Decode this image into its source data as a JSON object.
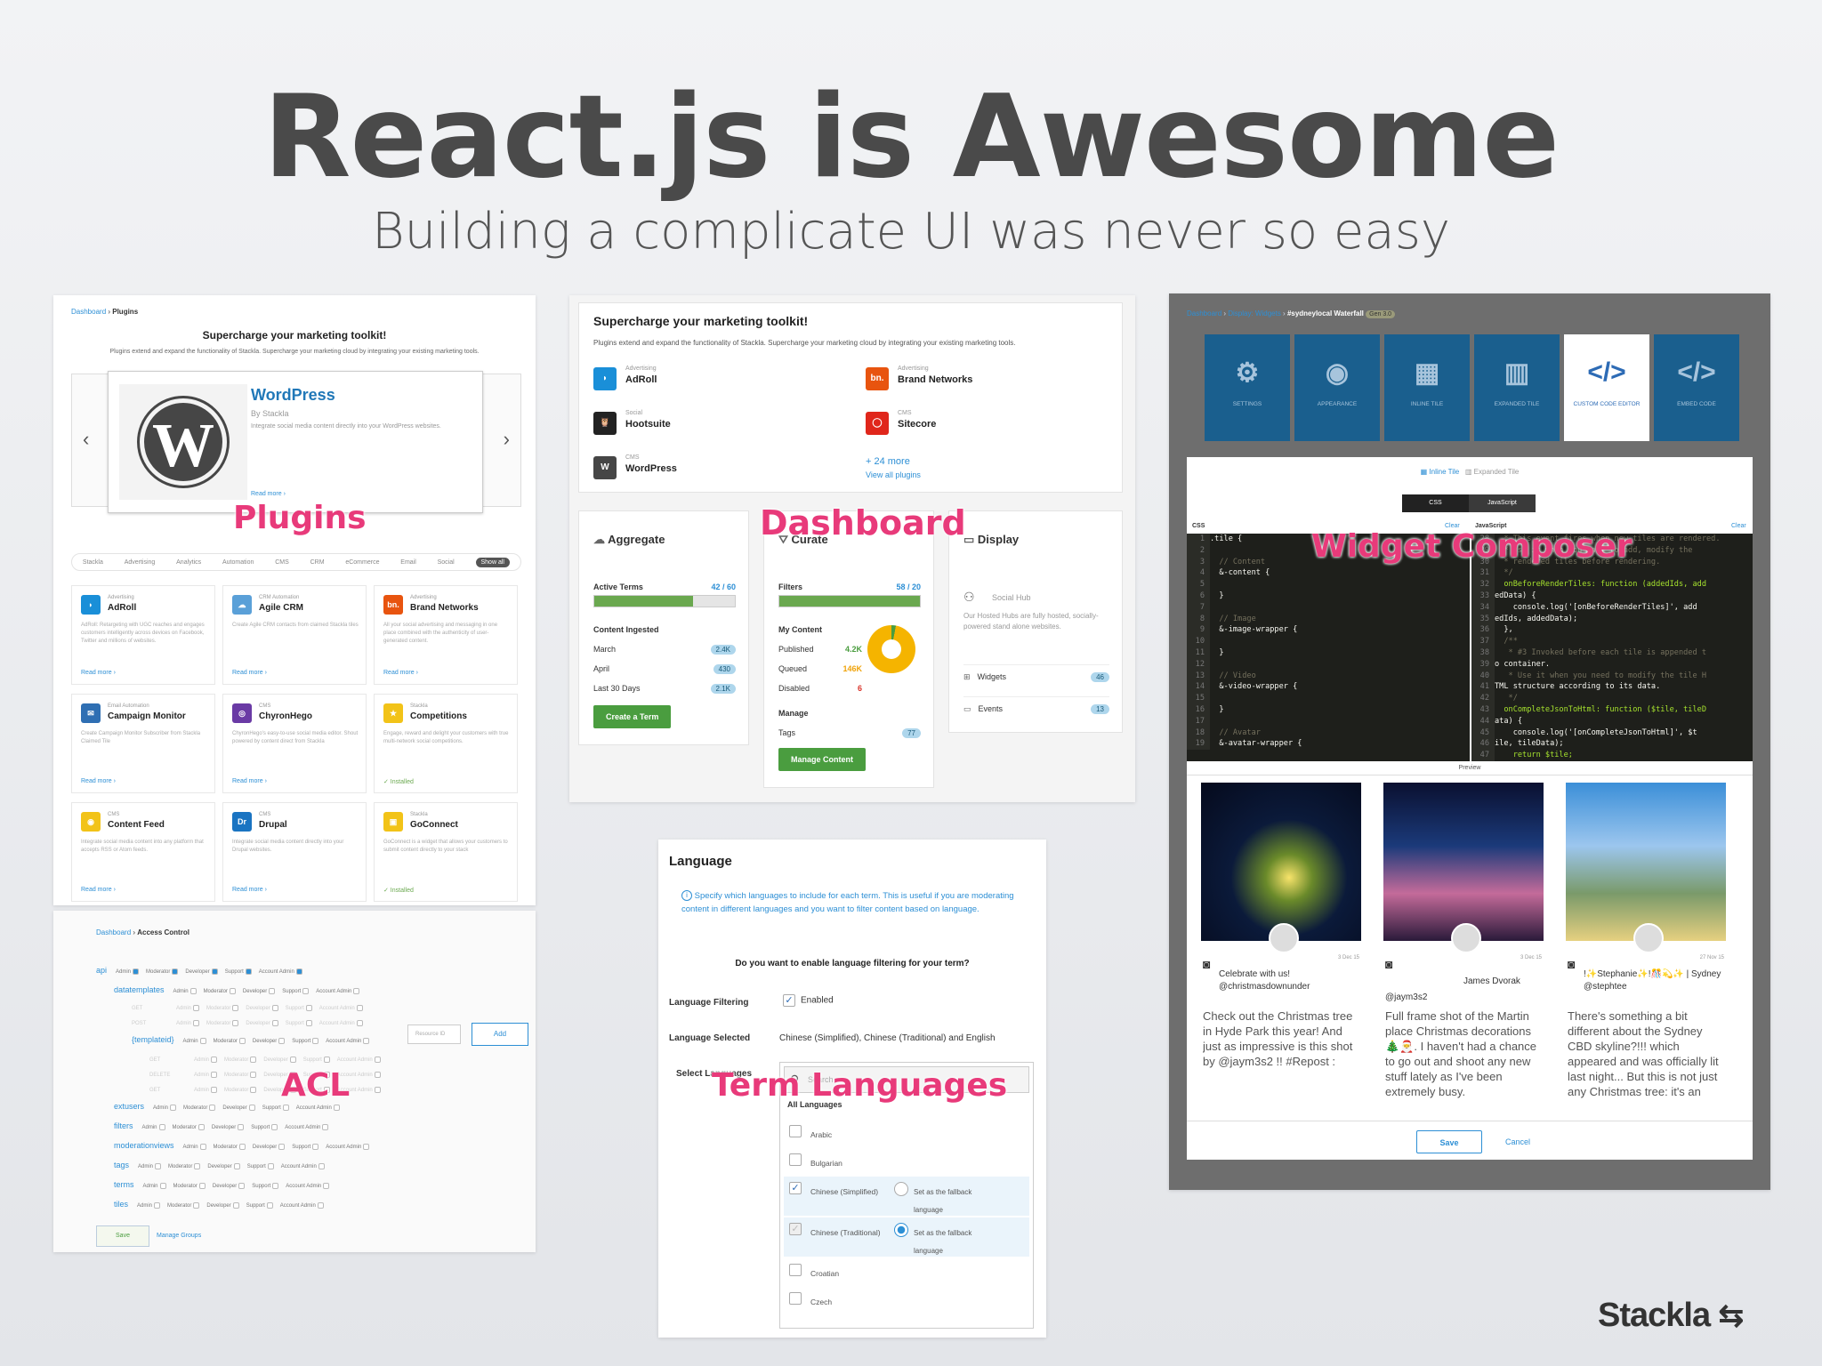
{
  "slide": {
    "title": "React.js is Awesome",
    "subtitle": "Building a complicate UI was never so easy",
    "brand": "Stackla"
  },
  "labels": {
    "plugins": "Plugins",
    "dashboard": "Dashboard",
    "widget": "Widget Composer",
    "acl": "ACL",
    "term_languages": "Term Languages"
  },
  "plugins": {
    "crumb_root": "Dashboard",
    "crumb_current": "Plugins",
    "heading": "Supercharge your marketing toolkit!",
    "desc": "Plugins extend and expand the functionality of Stackla. Supercharge your marketing cloud by integrating your existing marketing tools.",
    "featured": {
      "name": "WordPress",
      "by": "By Stackla",
      "desc": "Integrate social media content directly into your WordPress websites.",
      "read_more": "Read more ›"
    },
    "tabs": [
      "Stackla",
      "Advertising",
      "Analytics",
      "Automation",
      "CMS",
      "CRM",
      "eCommerce",
      "Email",
      "Social",
      "Show all"
    ],
    "cards": [
      {
        "cat": "Advertising",
        "name": "AdRoll",
        "desc": "AdRoll: Retargeting with UGC reaches and engages customers intelligently across devices on Facebook, Twitter and millions of websites.",
        "foot": "Read more ›",
        "color": "#1a8fd8",
        "glyph": "◗"
      },
      {
        "cat": "CRM Automation",
        "name": "Agile CRM",
        "desc": "Create Agile CRM contacts from claimed Stackla tiles",
        "foot": "Read more ›",
        "color": "#5aa0d8",
        "glyph": "☁"
      },
      {
        "cat": "Advertising",
        "name": "Brand Networks",
        "desc": "All your social advertising and messaging in one place combined with the authenticity of user-generated content.",
        "foot": "Read more ›",
        "color": "#e8540f",
        "glyph": "bn."
      },
      {
        "cat": "Email Automation",
        "name": "Campaign Monitor",
        "desc": "Create Campaign Monitor Subscriber from Stackla Claimed Tile",
        "foot": "Read more ›",
        "color": "#2f6fb3",
        "glyph": "✉"
      },
      {
        "cat": "CMS",
        "name": "ChyronHego",
        "desc": "ChyronHego's easy-to-use social media editor. Shout powered by content direct from Stackla",
        "foot": "Read more ›",
        "color": "#6a3aa5",
        "glyph": "◎"
      },
      {
        "cat": "Stackla",
        "name": "Competitions",
        "desc": "Engage, reward and delight your customers with true multi-network social competitions.",
        "foot": "✓ Installed",
        "color": "#f2c318",
        "glyph": "★"
      },
      {
        "cat": "CMS",
        "name": "Content Feed",
        "desc": "Integrate social media content into any platform that accepts RSS or Atom feeds.",
        "foot": "Read more ›",
        "color": "#f2c318",
        "glyph": "◉"
      },
      {
        "cat": "CMS",
        "name": "Drupal",
        "desc": "Integrate social media content directly into your Drupal websites.",
        "foot": "Read more ›",
        "color": "#1a74c2",
        "glyph": "Dr"
      },
      {
        "cat": "Stackla",
        "name": "GoConnect",
        "desc": "GoConnect is a widget that allows your customers to submit content directly to your stack",
        "foot": "✓ Installed",
        "color": "#f2c318",
        "glyph": "▣"
      }
    ]
  },
  "dashboard": {
    "heading": "Supercharge your marketing toolkit!",
    "desc": "Plugins extend and expand the functionality of Stackla. Supercharge your marketing cloud by integrating your existing marketing tools.",
    "plugins": [
      {
        "cat": "Advertising",
        "name": "AdRoll",
        "color": "#1a8fd8",
        "glyph": "◗"
      },
      {
        "cat": "Advertising",
        "name": "Brand Networks",
        "color": "#e8540f",
        "glyph": "bn."
      },
      {
        "cat": "Social",
        "name": "Hootsuite",
        "color": "#222",
        "glyph": "🦉"
      },
      {
        "cat": "CMS",
        "name": "Sitecore",
        "color": "#e0261b",
        "glyph": "◯"
      },
      {
        "cat": "CMS",
        "name": "WordPress",
        "color": "#464646",
        "glyph": "W"
      }
    ],
    "more": "+ 24 more",
    "view_all": "View all plugins",
    "aggregate": {
      "title": "Aggregate",
      "active_label": "Active Terms",
      "active_value": "42 / 60",
      "active_fill": 0.7,
      "ingested_label": "Content Ingested",
      "rows": [
        {
          "label": "March",
          "value": "2.4K"
        },
        {
          "label": "April",
          "value": "430"
        },
        {
          "label": "Last 30 Days",
          "value": "2.1K"
        }
      ],
      "button": "Create a Term"
    },
    "curate": {
      "title": "Curate",
      "filters_label": "Filters",
      "filters_value": "58 / 20",
      "filters_fill": 1.0,
      "my_content": "My Content",
      "rows": [
        {
          "label": "Published",
          "value": "4.2K",
          "color": "#4a9d3f"
        },
        {
          "label": "Queued",
          "value": "146K",
          "color": "#f0a30a"
        },
        {
          "label": "Disabled",
          "value": "6",
          "color": "#d9342b"
        }
      ],
      "manage": "Manage",
      "tags_label": "Tags",
      "tags_value": "77",
      "button": "Manage Content"
    },
    "display": {
      "title": "Display",
      "hub_label": "Social Hub",
      "hub_desc": "Our Hosted Hubs are fully hosted, socially-powered stand alone websites.",
      "rows": [
        {
          "label": "Widgets",
          "value": "46"
        },
        {
          "label": "Events",
          "value": "13"
        }
      ]
    }
  },
  "widget": {
    "crumb": [
      "Dashboard",
      "Display: Widgets",
      "#sydneylocal Waterfall"
    ],
    "badge": "Gen 3.0",
    "tabs": [
      {
        "label": "SETTINGS",
        "glyph": "⚙"
      },
      {
        "label": "APPEARANCE",
        "glyph": "◉"
      },
      {
        "label": "INLINE TILE",
        "glyph": "▦"
      },
      {
        "label": "EXPANDED TILE",
        "glyph": "▥"
      },
      {
        "label": "CUSTOM CODE EDITOR",
        "glyph": "</>"
      },
      {
        "label": "EMBED CODE",
        "glyph": "</>"
      }
    ],
    "subtabs": [
      "Inline Tile",
      "Expanded Tile"
    ],
    "toggle": [
      "CSS",
      "JavaScript"
    ],
    "css_label": "CSS",
    "clear": "Clear",
    "js_label": "JavaScript",
    "css_lines": [
      ".tile {",
      "",
      "  // Content",
      "  &-content {",
      "",
      "  }",
      "",
      "  // Image",
      "  &-image-wrapper {",
      "",
      "  }",
      "",
      "  // Video",
      "  &-video-wrapper {",
      "",
      "  }",
      "",
      "  // Avatar",
      "  &-avatar-wrapper {"
    ],
    "js_lines": [
      "  * This event fires when new tiles are rendered.",
      "  * Use it when you want to add, modify the",
      "  * rendered tiles before rendering.",
      "  */",
      "  onBeforeRenderTiles: function (addedIds, add",
      "edData) {",
      "    console.log('[onBeforeRenderTiles]', add",
      "edIds, addedData);",
      "  },",
      "  /**",
      "   * #3 Invoked before each tile is appended t",
      "o container.",
      "   * Use it when you need to modify the tile H",
      "TML structure according to its data.",
      "   */",
      "  onCompleteJsonToHtml: function ($tile, tileD",
      "ata) {",
      "    console.log('[onCompleteJsonToHtml]', $t",
      "ile, tileData);",
      "    return $tile;"
    ],
    "preview": "Preview",
    "tiles": [
      {
        "date": "3 Dec 15",
        "user": "Celebrate with us!",
        "handle": "@christmasdownunder",
        "text": "Check out the Christmas tree in Hyde Park this year! And just as impressive is this shot by @jaym3s2 !! #Repost :"
      },
      {
        "date": "3 Dec 15",
        "user": "James Dvorak",
        "handle": "@jaym3s2",
        "text": "Full frame shot of the Martin place Christmas decorations 🎄🎅. I haven't had a chance to go out and shoot any new stuff lately as I've been extremely busy."
      },
      {
        "date": "27 Nov 15",
        "user": "!✨Stephanie✨!🎊💫✨ | Sydney",
        "handle": "@stephtee",
        "text": "There's something a bit different about the Sydney CBD skyline?!!! which appeared and was officially lit last night... But this is not just any Christmas tree: it's an"
      }
    ],
    "save": "Save",
    "cancel": "Cancel"
  },
  "acl": {
    "crumb_root": "Dashboard",
    "crumb_current": "Access Control",
    "roles": [
      "Admin",
      "Moderator",
      "Developer",
      "Support",
      "Account Admin"
    ],
    "resources": [
      {
        "name": "api",
        "level": 0,
        "checked": [
          true,
          true,
          true,
          true,
          true
        ]
      },
      {
        "name": "datatemplates",
        "level": 1,
        "checked": [
          false,
          false,
          false,
          false,
          false
        ]
      },
      {
        "name": "GET",
        "level": 2,
        "checked": [
          false,
          false,
          false,
          false,
          false
        ]
      },
      {
        "name": "POST",
        "level": 2,
        "checked": [
          false,
          false,
          false,
          false,
          false
        ]
      },
      {
        "name": "{templateid}",
        "level": 2,
        "checked": [
          false,
          false,
          false,
          false,
          false
        ]
      },
      {
        "name": "GET",
        "level": 3,
        "checked": [
          false,
          false,
          false,
          false,
          false
        ]
      },
      {
        "name": "DELETE",
        "level": 3,
        "checked": [
          false,
          false,
          false,
          false,
          false
        ]
      },
      {
        "name": "GET",
        "level": 3,
        "checked": [
          false,
          false,
          false,
          false,
          false
        ]
      },
      {
        "name": "extusers",
        "level": 1,
        "checked": [
          false,
          false,
          false,
          false,
          false
        ]
      },
      {
        "name": "filters",
        "level": 1,
        "checked": [
          false,
          false,
          false,
          false,
          false
        ]
      },
      {
        "name": "moderationviews",
        "level": 1,
        "checked": [
          false,
          false,
          false,
          false,
          false
        ]
      },
      {
        "name": "tags",
        "level": 1,
        "checked": [
          false,
          false,
          false,
          false,
          false
        ]
      },
      {
        "name": "terms",
        "level": 1,
        "checked": [
          false,
          false,
          false,
          false,
          false
        ]
      },
      {
        "name": "tiles",
        "level": 1,
        "checked": [
          false,
          false,
          false,
          false,
          false
        ]
      }
    ],
    "resource_placeholder": "Resource ID",
    "add": "Add",
    "save": "Save",
    "manage_groups": "Manage Groups"
  },
  "language": {
    "title": "Language",
    "info": "Specify which languages to include for each term. This is useful if you are moderating content in different languages and you want to filter content based on language.",
    "question": "Do you want to enable language filtering for your term?",
    "filtering_label": "Language Filtering",
    "enabled": "Enabled",
    "selected_label": "Language Selected",
    "selected_value": "Chinese (Simplified), Chinese (Traditional) and English",
    "select_label": "Select Languages",
    "search_placeholder": "Search",
    "all": "All Languages",
    "langs": [
      {
        "name": "Arabic",
        "checked": false,
        "fallback": false,
        "showFallback": false
      },
      {
        "name": "Bulgarian",
        "checked": false,
        "fallback": false,
        "showFallback": false
      },
      {
        "name": "Chinese (Simplified)",
        "checked": true,
        "fallback": false,
        "showFallback": true
      },
      {
        "name": "Chinese (Traditional)",
        "checked": true,
        "fallback": true,
        "showFallback": true
      },
      {
        "name": "Croatian",
        "checked": false,
        "fallback": false,
        "showFallback": false
      },
      {
        "name": "Czech",
        "checked": false,
        "fallback": false,
        "showFallback": false
      }
    ],
    "fallback_text": "Set as the fallback language"
  }
}
